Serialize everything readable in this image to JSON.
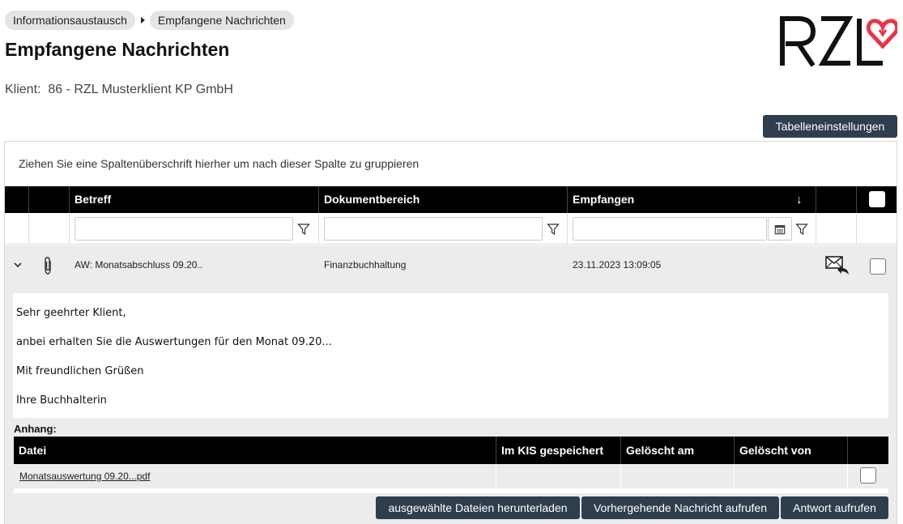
{
  "breadcrumb": [
    {
      "label": "Informationsaustausch"
    },
    {
      "label": "Empfangene Nachrichten"
    }
  ],
  "page": {
    "title": "Empfangene Nachrichten",
    "client": "Klient:  86 - RZL Musterklient KP GmbH"
  },
  "logo": {
    "text": "RZL",
    "heart_color": "#e8344a"
  },
  "toolbar": {
    "table_settings_label": "Tabelleneinstellungen"
  },
  "grid": {
    "group_hint": "Ziehen Sie eine Spaltenüberschrift hierher um nach dieser Spalte zu gruppieren",
    "columns": {
      "subject": "Betreff",
      "area": "Dokumentbereich",
      "received": "Empfangen",
      "sort_indicator": "↓"
    },
    "rows": [
      {
        "subject": "AW: Monatsabschluss 09.20..",
        "area": "Finanzbuchhaltung",
        "received": "23.11.2023 13:09:05",
        "has_attachment": true,
        "expanded": true
      }
    ]
  },
  "message": {
    "lines": [
      "Sehr geehrter Klient,",
      "anbei erhalten Sie die Auswertungen für den Monat 09.20...",
      "Mit freundlichen Grüßen",
      "Ihre Buchhalterin"
    ],
    "attachments_label": "Anhang:",
    "attachment_columns": {
      "file": "Datei",
      "saved": "Im KIS gespeichert",
      "deleted_on": "Gelöscht am",
      "deleted_by": "Gelöscht von"
    },
    "attachments": [
      {
        "file": "Monatsauswertung 09.20...pdf",
        "saved": "",
        "deleted_on": "",
        "deleted_by": ""
      }
    ]
  },
  "actions": {
    "download_label": "ausgewählte Dateien herunterladen",
    "previous_label": "Vorhergehende Nachricht aufrufen",
    "reply_label": "Antwort aufrufen"
  },
  "colors": {
    "header_bg": "#000000",
    "button_bg": "#2f3e4e",
    "row_bg": "#ececec",
    "crumb_bg": "#e4e4e4"
  }
}
